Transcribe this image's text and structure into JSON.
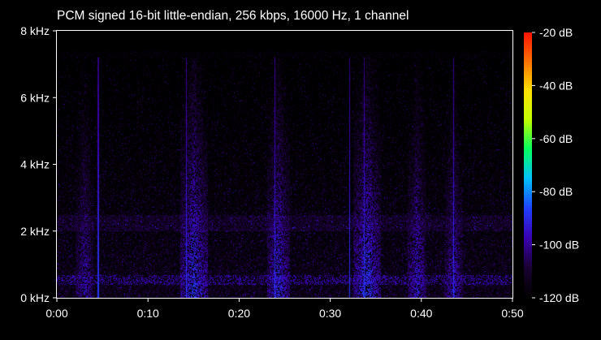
{
  "chart_data": {
    "type": "heatmap",
    "title": "PCM signed 16-bit little-endian, 256 kbps, 16000 Hz, 1 channel",
    "x_ticks": [
      "0:00",
      "0:10",
      "0:20",
      "0:30",
      "0:40",
      "0:50"
    ],
    "x_tick_values": [
      0,
      10,
      20,
      30,
      40,
      50
    ],
    "xlim": [
      0,
      50
    ],
    "y_ticks": [
      "0 kHz",
      "2 kHz",
      "4 kHz",
      "6 kHz",
      "8 kHz"
    ],
    "y_tick_values": [
      0,
      2,
      4,
      6,
      8
    ],
    "ylim": [
      0,
      8
    ],
    "colorbar": {
      "ticks": [
        "-20 dB",
        "-40 dB",
        "-60 dB",
        "-80 dB",
        "-100 dB",
        "-120 dB"
      ],
      "tick_values": [
        -20,
        -40,
        -60,
        -80,
        -100,
        -120
      ],
      "range": [
        -120,
        -20
      ],
      "colors": [
        "#000000",
        "#1a0033",
        "#3a00b0",
        "#2040ff",
        "#00c0ff",
        "#00ff60",
        "#c0ff00",
        "#ffe000",
        "#ff7000",
        "#ff1000"
      ],
      "placement": "right"
    },
    "transients_s": [
      4.5,
      14.2,
      23.9,
      32.1,
      33.7,
      43.5
    ],
    "speech_bursts": [
      {
        "t_start": 2.0,
        "t_end": 4.0,
        "db": -95
      },
      {
        "t_start": 13.5,
        "t_end": 16.5,
        "db": -88
      },
      {
        "t_start": 23.0,
        "t_end": 25.5,
        "db": -90
      },
      {
        "t_start": 32.5,
        "t_end": 35.5,
        "db": -88
      },
      {
        "t_start": 38.5,
        "t_end": 40.5,
        "db": -92
      },
      {
        "t_start": 42.5,
        "t_end": 44.5,
        "db": -94
      }
    ],
    "dominant_band_khz": [
      0.0,
      2.5
    ],
    "noise_floor_db": -115,
    "background_color": "#000000"
  }
}
